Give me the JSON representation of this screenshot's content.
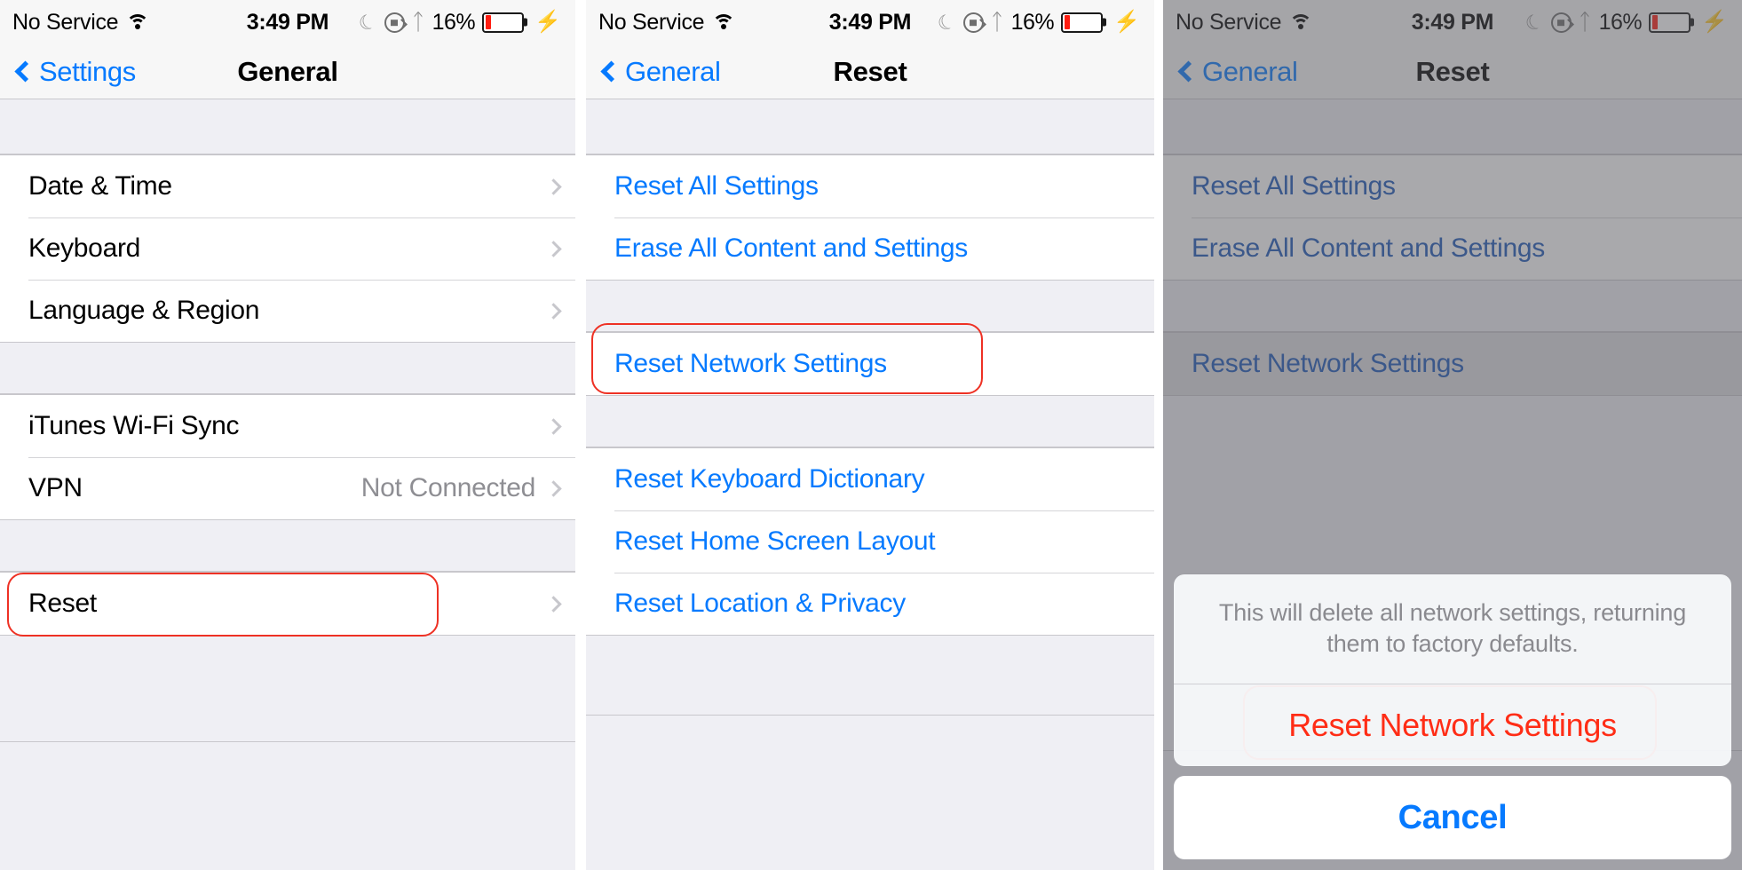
{
  "status_bar": {
    "carrier": "No Service",
    "wifi_icon": "wifi-icon",
    "time": "3:49 PM",
    "dnd_icon": "moon-icon",
    "rotation_lock_icon": "rotation-lock-icon",
    "bluetooth_icon": "bluetooth-icon",
    "battery_percent": "16%",
    "battery_level": 16,
    "charging_icon": "lightning-bolt-icon"
  },
  "colors": {
    "accent_blue": "#067aff",
    "destructive_red": "#ff2d16",
    "annotation_red": "#ee3124",
    "group_background": "#efeff4",
    "row_background": "#ffffff",
    "separator": "#c8c7cc",
    "secondary_text": "#8e8e93"
  },
  "panel1": {
    "nav": {
      "back_label": "Settings",
      "title": "General",
      "back_icon": "chevron-left-icon"
    },
    "groups": [
      {
        "rows": [
          {
            "label": "Date & Time",
            "value": "",
            "disclosure": true
          },
          {
            "label": "Keyboard",
            "value": "",
            "disclosure": true
          },
          {
            "label": "Language & Region",
            "value": "",
            "disclosure": true
          }
        ]
      },
      {
        "rows": [
          {
            "label": "iTunes Wi-Fi Sync",
            "value": "",
            "disclosure": true
          },
          {
            "label": "VPN",
            "value": "Not Connected",
            "disclosure": true
          }
        ]
      },
      {
        "rows": [
          {
            "label": "Reset",
            "value": "",
            "disclosure": true,
            "annotated": true
          }
        ]
      }
    ]
  },
  "panel2": {
    "nav": {
      "back_label": "General",
      "title": "Reset",
      "back_icon": "chevron-left-icon"
    },
    "groups": [
      {
        "rows": [
          {
            "label": "Reset All Settings"
          },
          {
            "label": "Erase All Content and Settings"
          }
        ]
      },
      {
        "rows": [
          {
            "label": "Reset Network Settings",
            "annotated": true
          }
        ]
      },
      {
        "rows": [
          {
            "label": "Reset Keyboard Dictionary"
          },
          {
            "label": "Reset Home Screen Layout"
          },
          {
            "label": "Reset Location & Privacy"
          }
        ]
      }
    ]
  },
  "panel3": {
    "nav": {
      "back_label": "General",
      "title": "Reset",
      "back_icon": "chevron-left-icon"
    },
    "groups": [
      {
        "rows": [
          {
            "label": "Reset All Settings"
          },
          {
            "label": "Erase All Content and Settings"
          }
        ]
      },
      {
        "rows": [
          {
            "label": "Reset Network Settings",
            "pressed": true
          }
        ]
      }
    ],
    "action_sheet": {
      "message": "This will delete all network settings, returning them to factory defaults.",
      "destructive_label": "Reset Network Settings",
      "destructive_annotated": true,
      "cancel_label": "Cancel"
    }
  }
}
